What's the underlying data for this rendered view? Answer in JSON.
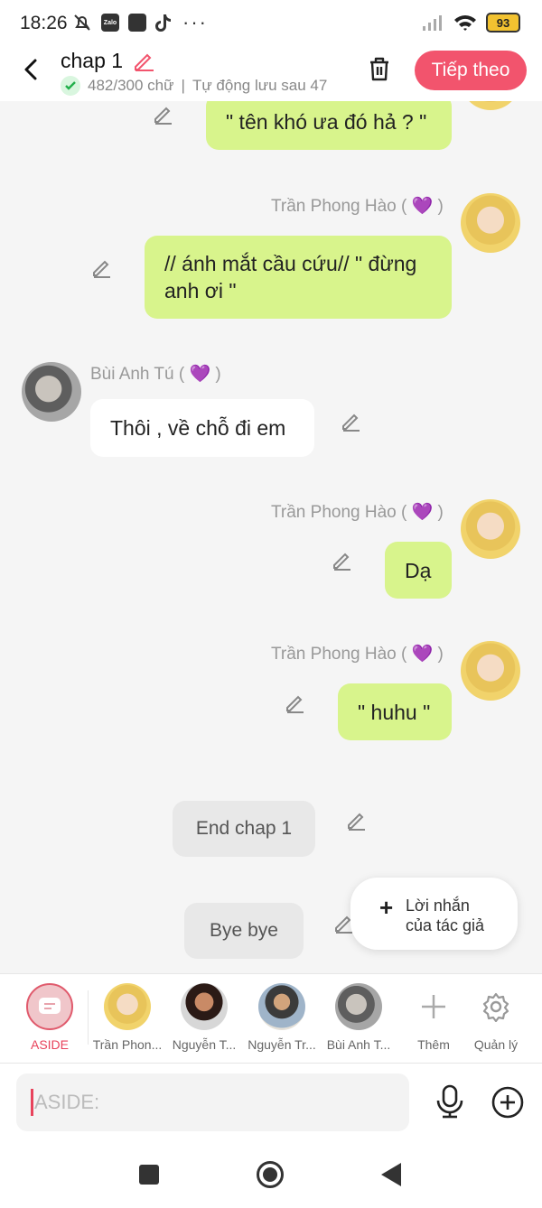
{
  "status_bar": {
    "time": "18:26",
    "battery": "93",
    "app_badge_zalo": "Zalo",
    "more": "···"
  },
  "header": {
    "title": "chap 1",
    "word_count": "482/300 chữ",
    "autosave": "Tự động lưu sau 47",
    "separator": "|",
    "next_button": "Tiếp theo"
  },
  "messages": [
    {
      "side": "right",
      "sender": "",
      "text": "\" tên khó ưa đó hả ? \""
    },
    {
      "side": "right",
      "sender": "Trần Phong Hào ( 💜 )",
      "text": "// ánh mắt cầu cứu// \" đừng anh ơi \""
    },
    {
      "side": "left",
      "sender": "Bùi Anh Tú ( 💜 )",
      "text": "Thôi , về chỗ đi em"
    },
    {
      "side": "right",
      "sender": "Trần Phong Hào ( 💜 )",
      "text": "Dạ"
    },
    {
      "side": "right",
      "sender": "Trần Phong Hào ( 💜 )",
      "text": "\" huhu \""
    },
    {
      "side": "center",
      "sender": "",
      "text": "End chap 1"
    },
    {
      "side": "center",
      "sender": "",
      "text": "Bye bye"
    }
  ],
  "author_note": {
    "plus": "+",
    "line1": "Lời nhắn",
    "line2": "của tác giả"
  },
  "characters": [
    {
      "label": "ASIDE",
      "selected": true
    },
    {
      "label": "Trần Phon..."
    },
    {
      "label": "Nguyễn T..."
    },
    {
      "label": "Nguyễn Tr..."
    },
    {
      "label": "Bùi Anh T..."
    }
  ],
  "actions": {
    "add_label": "Thêm",
    "manage_label": "Quản lý"
  },
  "input": {
    "placeholder": "ASIDE:"
  },
  "colors": {
    "accent": "#f2546d",
    "bubble_green": "#d8f48c",
    "bubble_white": "#ffffff",
    "narration_grey": "#e8e8e8"
  }
}
